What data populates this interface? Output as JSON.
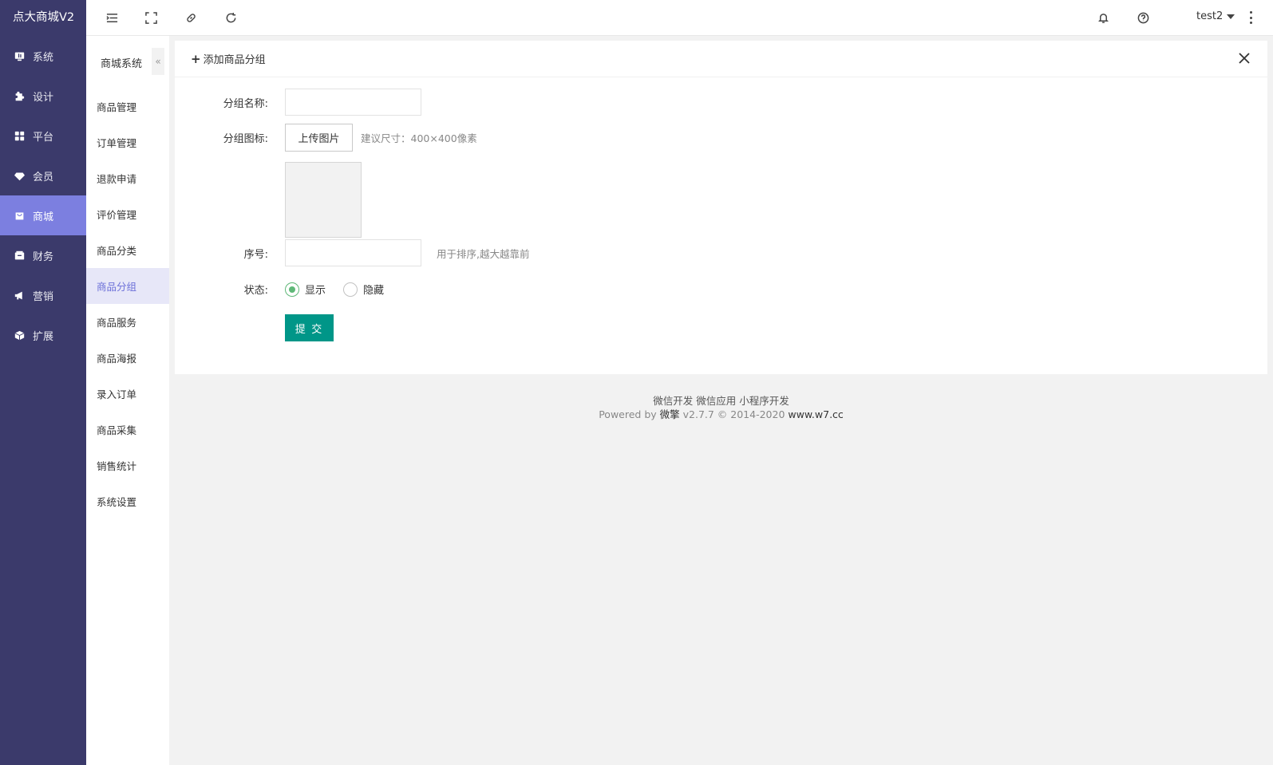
{
  "brand": "点大商城V2",
  "main_nav": [
    {
      "label": "系统",
      "icon": "monitor-icon",
      "active": false
    },
    {
      "label": "设计",
      "icon": "puzzle-icon",
      "active": false
    },
    {
      "label": "平台",
      "icon": "grid-icon",
      "active": false
    },
    {
      "label": "会员",
      "icon": "diamond-icon",
      "active": false
    },
    {
      "label": "商城",
      "icon": "shop-icon",
      "active": true
    },
    {
      "label": "财务",
      "icon": "wallet-icon",
      "active": false
    },
    {
      "label": "营销",
      "icon": "megaphone-icon",
      "active": false
    },
    {
      "label": "扩展",
      "icon": "cube-icon",
      "active": false
    }
  ],
  "topbar": {
    "user": "test2"
  },
  "sub_nav": {
    "title": "商城系统",
    "collapse_glyph": "«",
    "items": [
      {
        "label": "商品管理",
        "active": false
      },
      {
        "label": "订单管理",
        "active": false
      },
      {
        "label": "退款申请",
        "active": false
      },
      {
        "label": "评价管理",
        "active": false
      },
      {
        "label": "商品分类",
        "active": false
      },
      {
        "label": "商品分组",
        "active": true
      },
      {
        "label": "商品服务",
        "active": false
      },
      {
        "label": "商品海报",
        "active": false
      },
      {
        "label": "录入订单",
        "active": false
      },
      {
        "label": "商品采集",
        "active": false
      },
      {
        "label": "销售统计",
        "active": false
      },
      {
        "label": "系统设置",
        "active": false
      }
    ]
  },
  "form": {
    "title": "添加商品分组",
    "name_label": "分组名称:",
    "name_value": "",
    "icon_label": "分组图标:",
    "upload_label": "上传图片",
    "upload_hint": "建议尺寸：400×400像素",
    "order_label": "序号:",
    "order_value": "",
    "order_hint": "用于排序,越大越靠前",
    "status_label": "状态:",
    "status_options": [
      {
        "label": "显示",
        "checked": true
      },
      {
        "label": "隐藏",
        "checked": false
      }
    ],
    "submit_label": "提 交"
  },
  "footer": {
    "links": "微信开发 微信应用 小程序开发",
    "powered_prefix": "Powered by ",
    "powered_brand": "微擎",
    "powered_version": " v2.7.7 © 2014-2020 ",
    "powered_site": "www.w7.cc"
  },
  "colors": {
    "sidebar_bg": "#3b3a6b",
    "sidebar_active": "#7c7fe0",
    "subnav_active_bg": "#e7e7f8",
    "subnav_active_text": "#6b6fd8",
    "submit_bg": "#009688",
    "radio_on": "#5fb878"
  }
}
